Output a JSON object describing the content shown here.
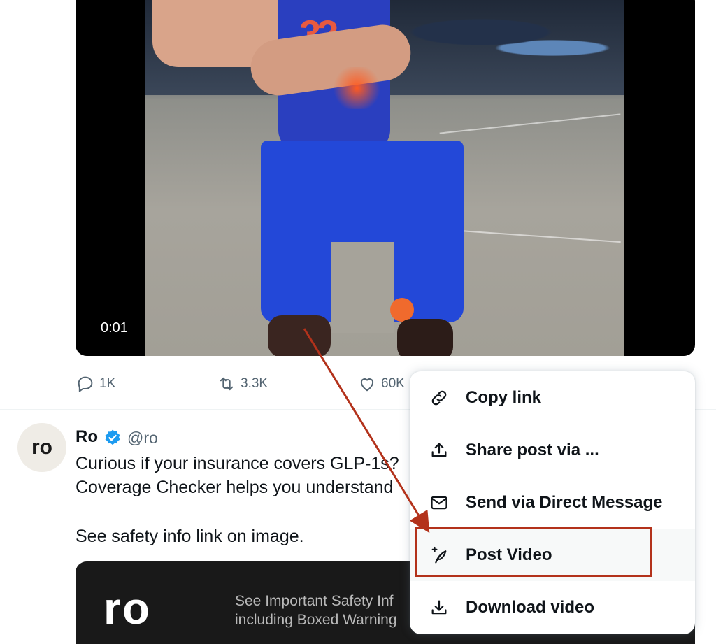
{
  "video": {
    "timestamp": "0:01",
    "jersey_number": "32"
  },
  "actions": {
    "replies": "1K",
    "reposts": "3.3K",
    "likes": "60K"
  },
  "post": {
    "avatar_text": "ro",
    "author_name": "Ro",
    "handle": "@ro",
    "line1": "Curious if your insurance covers GLP-1s?",
    "line2": "Coverage Checker helps you understand",
    "line3": "See safety info link on image.",
    "ad": {
      "logo": "ro",
      "line1": "See Important Safety Inf",
      "line2": "including Boxed Warning"
    }
  },
  "menu": {
    "items": [
      {
        "label": "Copy link",
        "icon": "link-icon"
      },
      {
        "label": "Share post via ...",
        "icon": "share-icon"
      },
      {
        "label": "Send via Direct Message",
        "icon": "envelope-icon"
      },
      {
        "label": "Post Video",
        "icon": "feather-plus-icon"
      },
      {
        "label": "Download video",
        "icon": "download-icon"
      }
    ]
  },
  "colors": {
    "annotation": "#b3321b",
    "verified": "#1d9bf0",
    "secondary_text": "#536471"
  }
}
